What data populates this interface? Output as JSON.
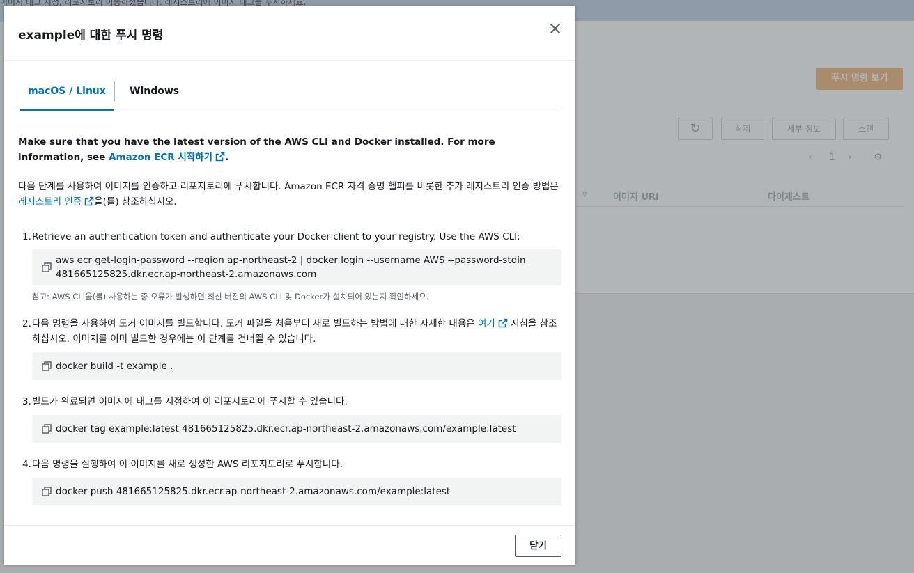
{
  "background": {
    "banner_text": "이미지 태그 지정, 리포지토리 이동하셨습니다. 레지스트리에 이미지 태그를 푸시하세요.",
    "push_button": "푸시 명령 보기",
    "refresh_icon": "refresh-icon",
    "delete_button": "삭제",
    "details_button": "세부 정보",
    "scan_button": "스캔",
    "page_number": "1",
    "columns": [
      "이미지 URI",
      "다이제스트"
    ]
  },
  "modal": {
    "title": "example에 대한 푸시 명령",
    "tabs": [
      {
        "label": "macOS / Linux",
        "active": true
      },
      {
        "label": "Windows",
        "active": false
      }
    ],
    "intro_bold": "Make sure that you have the latest version of the AWS CLI and Docker installed. For more information, see ",
    "intro_bold_link": "Amazon ECR 시작하기",
    "intro_bold_end": ".",
    "intro_text": "다음 단계를 사용하여 이미지를 인증하고 리포지토리에 푸시합니다. Amazon ECR 자격 증명 헬퍼를 비롯한 추가 레지스트리 인증 방법은 ",
    "intro_text_link": "레지스트리 인증",
    "intro_text_end": "을(를) 참조하십시오.",
    "steps": [
      {
        "num": "1.",
        "text": "Retrieve an authentication token and authenticate your Docker client to your registry. Use the AWS CLI:",
        "command": "aws ecr get-login-password --region ap-northeast-2 | docker login --username AWS --password-stdin\n481665125825.dkr.ecr.ap-northeast-2.amazonaws.com"
      },
      {
        "num": "2.",
        "text_before": "다음 명령을 사용하여 도커 이미지를 빌드합니다. 도커 파일을 처음부터 새로 빌드하는 방법에 대한 자세한 내용은 ",
        "text_link": "여기",
        "text_after": " 지침을 참조하십시오. 이미지를 이미 빌드한 경우에는 이 단계를 건너뛸 수 있습니다.",
        "command": "docker build -t example ."
      },
      {
        "num": "3.",
        "text": "빌드가 완료되면 이미지에 태그를 지정하여 이 리포지토리에 푸시할 수 있습니다.",
        "command": "docker tag example:latest 481665125825.dkr.ecr.ap-northeast-2.amazonaws.com/example:latest"
      },
      {
        "num": "4.",
        "text": "다음 명령을 실행하여 이 이미지를 새로 생성한 AWS 리포지토리로 푸시합니다.",
        "command": "docker push 481665125825.dkr.ecr.ap-northeast-2.amazonaws.com/example:latest"
      }
    ],
    "note": "참고: AWS CLI을(를) 사용하는 중 오류가 발생하면 최신 버전의 AWS CLI 및 Docker가 설치되어 있는지 확인하세요.",
    "close_label": "닫기",
    "icons": {
      "close": "close-icon",
      "copy": "copy-icon",
      "external": "external-link-icon"
    },
    "colors": {
      "link": "#0073bb",
      "code_bg": "#f2f3f3",
      "text": "#16191f"
    }
  }
}
